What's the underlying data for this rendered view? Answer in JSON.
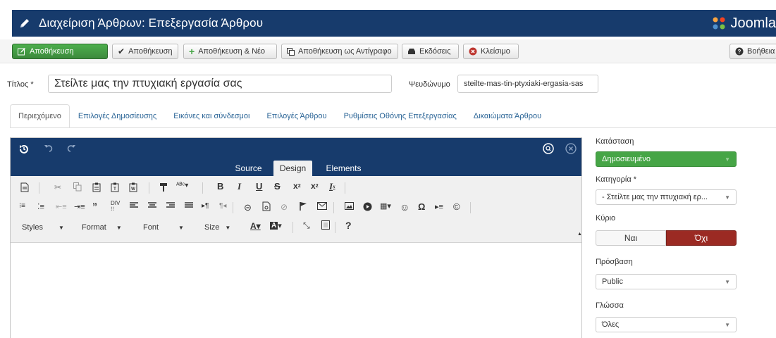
{
  "header": {
    "title": "Διαχείριση Άρθρων: Επεξεργασία Άρθρου",
    "brand": "Joomla"
  },
  "toolbar": {
    "save": "Αποθήκευση",
    "save2": "Αποθήκευση",
    "save_new": "Αποθήκευση & Νέο",
    "save_copy": "Αποθήκευση ως Αντίγραφο",
    "versions": "Εκδόσεις",
    "close": "Κλείσιμο",
    "help": "Βοήθεια"
  },
  "form": {
    "title_label": "Τίτλος *",
    "title_value": "Στείλτε μας την πτυχιακή εργασία σας",
    "alias_label": "Ψευδώνυμο",
    "alias_value": "steilte-mas-tin-ptyxiaki-ergasia-sas"
  },
  "tabs": [
    "Περιεχόμενο",
    "Επιλογές Δημοσίευσης",
    "Εικόνες και σύνδεσμοι",
    "Επιλογές Άρθρου",
    "Ρυθμίσεις Οθόνης Επεξεργασίας",
    "Δικαιώματα Άρθρου"
  ],
  "editor": {
    "modes": [
      "Source",
      "Design",
      "Elements"
    ],
    "active_mode": "Design",
    "dropdowns": [
      "Styles",
      "Format",
      "Font",
      "Size"
    ]
  },
  "sidebar": {
    "status_label": "Κατάσταση",
    "status_value": "Δημοσιευμένο",
    "category_label": "Κατηγορία *",
    "category_value": "- Στείλτε μας την πτυχιακή ερ...",
    "featured_label": "Κύριο",
    "featured_yes": "Ναι",
    "featured_no": "Όχι",
    "access_label": "Πρόσβαση",
    "access_value": "Public",
    "language_label": "Γλώσσα",
    "language_value": "Όλες"
  }
}
